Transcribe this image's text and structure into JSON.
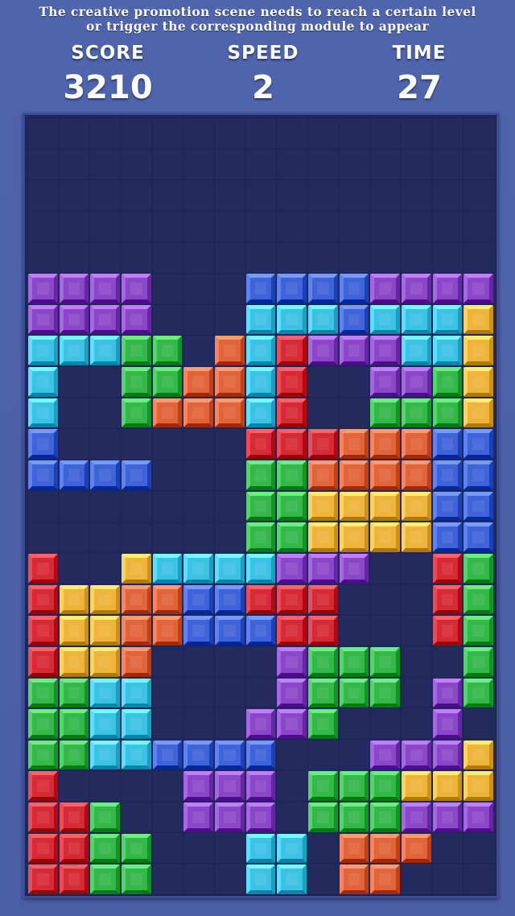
{
  "banner": {
    "line1": "The creative promotion scene needs to reach a certain level",
    "line2": "or trigger the corresponding module to appear"
  },
  "stats": {
    "score_label": "SCORE",
    "score_value": "3210",
    "speed_label": "SPEED",
    "speed_value": "2",
    "time_label": "TIME",
    "time_value": "27"
  },
  "colors": {
    "P": "#8a48c8",
    "B": "#3f63d8",
    "C": "#3cc2e4",
    "G": "#35b84a",
    "O": "#e2643a",
    "R": "#d62a34",
    "Y": "#eeb53a"
  },
  "board": {
    "cols": 15,
    "rows": 25,
    "cells": [
      "...............",
      "...............",
      "...............",
      "...............",
      "...............",
      "PPPP...BBBBPPPP",
      "PPPP...CCCBCCCY",
      "CCCGG.OCRPPPCCY",
      "C..GGOOCR..PPGY",
      "C..GOOOCR..GGGY",
      "B......RRROOOBB",
      "BBBB...GGOOOOBB",
      ".......GGYYYYBB",
      ".......GGYYYYBB",
      "R..YCCCCPPP..RG",
      "RYYOOBBRRR...RG",
      "RYYOOBBBRR...RG",
      "RYYO....PGGG..G",
      "GGCC....PGGG.PG",
      "GGCC...PPG...P.",
      "GGCCBBBB...PPPY",
      "R....PPP.GGGYYY",
      "RRG..PPP.GGGPPP",
      "RRGG...CC.OOO..",
      "RRGG...CC.OO..."
    ]
  }
}
